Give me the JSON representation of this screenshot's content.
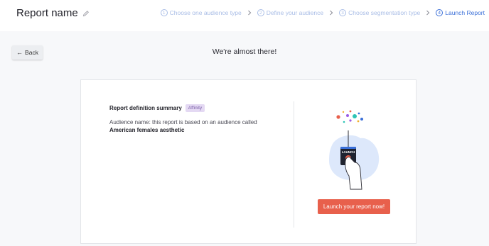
{
  "header": {
    "title": "Report name",
    "steps": [
      {
        "number": "1",
        "label": "Choose one audience type"
      },
      {
        "number": "2",
        "label": "Define your audience"
      },
      {
        "number": "3",
        "label": "Choose segmentation type"
      },
      {
        "number": "4",
        "label": "Launch Report"
      }
    ],
    "active_step": 4
  },
  "back_button": {
    "label": "Back",
    "icon": "arrow-left-icon"
  },
  "main": {
    "heading": "We're almost there!",
    "summary": {
      "title": "Report definition summary",
      "badge": "Affinity",
      "description": "Audience name: this report is based on an audience called",
      "audience_name": "American females aesthetic"
    },
    "illustration": {
      "button_text": "LAUNCH"
    },
    "launch_button": "Launch your report now!"
  },
  "colors": {
    "accent": "#3a6fd8",
    "step_inactive": "#a9bde6",
    "launch": "#e8604c",
    "badge_bg": "#e4d9f3",
    "badge_text": "#7a5ea6"
  }
}
